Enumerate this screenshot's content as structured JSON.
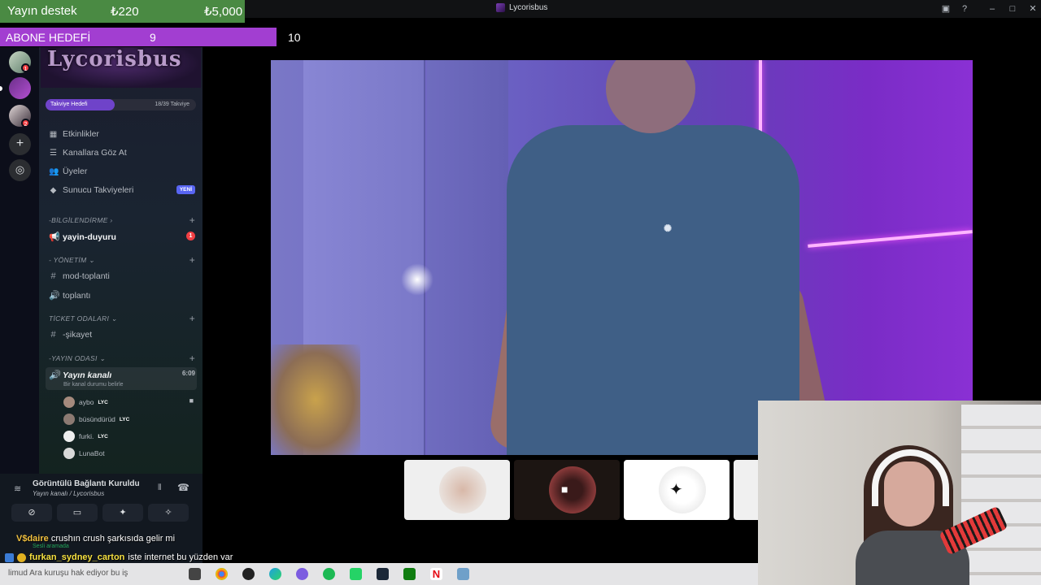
{
  "window": {
    "title": "Lycorisbus"
  },
  "overlay": {
    "donation": {
      "label": "Yayın destek",
      "current": "₺220",
      "goal": "₺5,000"
    },
    "sub_goal": {
      "label": "ABONE HEDEFİ",
      "current": "9",
      "target": "10",
      "progress": 0.9
    }
  },
  "server": {
    "banner_name": "Lycorisbus",
    "boost": {
      "label": "Takviye Hedefi",
      "count": "18/39 Takviye",
      "progress": 0.46
    },
    "menu": [
      {
        "label": "Etkinlikler",
        "icon": "calendar-icon"
      },
      {
        "label": "Kanallara Göz At",
        "icon": "browse-icon"
      },
      {
        "label": "Üyeler",
        "icon": "members-icon"
      },
      {
        "label": "Sunucu Takviyeleri",
        "icon": "boost-icon",
        "badge": "YENİ"
      }
    ],
    "categories": [
      {
        "name": "-BİLGİLENDİRME",
        "channels": [
          {
            "name": "yayin-duyuru",
            "mention": "1"
          }
        ]
      },
      {
        "name": "- YÖNETİM",
        "channels": [
          {
            "name": "mod-toplanti"
          },
          {
            "name": "toplantı"
          }
        ]
      },
      {
        "name": "TİCKET ODALARI",
        "channels": [
          {
            "name": "-şikayet"
          }
        ]
      },
      {
        "name": "-YAYIN ODASI",
        "channels": [
          {
            "name": "Yayın kanalı",
            "time": "6:09",
            "status": "Bir kanal durumu belirle"
          }
        ]
      }
    ],
    "voice_users": [
      {
        "name": "aybo",
        "tag": "LYC"
      },
      {
        "name": "büsündürüd",
        "tag": "LYC"
      },
      {
        "name": "furki.",
        "tag": "LYC"
      },
      {
        "name": "LunaBot",
        "tag": ""
      }
    ],
    "server_badges": [
      "1",
      "2"
    ]
  },
  "voice_panel": {
    "status": "Görüntülü Bağlantı Kuruldu",
    "channel": "Yayın kanalı / Lycorisbus",
    "sub_status": "Sesli aramada"
  },
  "chat": [
    {
      "user": "V$daire",
      "message": "crushın crush şarkısıda gelir mi"
    },
    {
      "user": "furkan_sydney_carton",
      "message": "iste internet bu yüzden var"
    }
  ],
  "taskbar": {
    "ticker": "limud Ara kuruşu hak ediyor bu iş"
  },
  "colors": {
    "accent": "#a23ed1",
    "donation": "#4a8a43",
    "mention": "#f23f43",
    "new_badge": "#5865f2"
  }
}
